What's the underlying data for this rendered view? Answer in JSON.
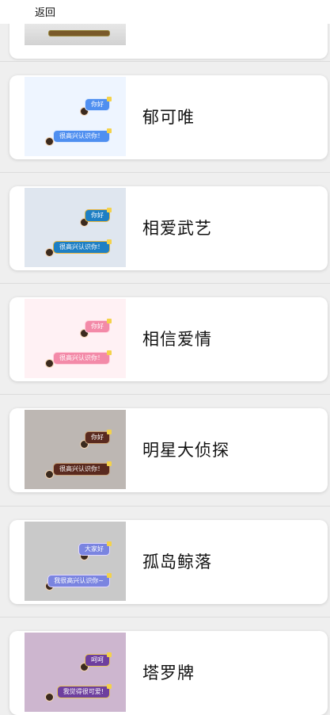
{
  "header": {
    "back_label": "返回"
  },
  "themes": [
    {
      "title": "郁可唯",
      "bubble_short": "你好",
      "bubble_long": "很高兴认识你！",
      "bg": "#eef5ff",
      "bubble_color": "#4f8ff0",
      "border_color": "#d6e6ff",
      "text_color": "#ffffff"
    },
    {
      "title": "相爱武艺",
      "bubble_short": "你好",
      "bubble_long": "很高兴认识你！",
      "bg": "#dfe6ef",
      "bubble_color": "#1d7fc4",
      "border_color": "#e7b43a",
      "text_color": "#ffffff"
    },
    {
      "title": "相信爱情",
      "bubble_short": "你好",
      "bubble_long": "很高兴认识你！",
      "bg": "#fff1f4",
      "bubble_color": "#f38aa8",
      "border_color": "#ffd1dd",
      "text_color": "#ffffff"
    },
    {
      "title": "明星大侦探",
      "bubble_short": "你好",
      "bubble_long": "很高兴认识你！",
      "bg": "#bdb7b3",
      "bubble_color": "#5a2a1f",
      "border_color": "#c9a27a",
      "text_color": "#ffffff"
    },
    {
      "title": "孤岛鲸落",
      "bubble_short": "大家好",
      "bubble_long": "我很高兴认识你~",
      "bg": "#c9c9c9",
      "bubble_color": "#7a84e0",
      "border_color": "#e2d8ff",
      "text_color": "#ffffff"
    },
    {
      "title": "塔罗牌",
      "bubble_short": "呵呵",
      "bubble_long": "我觉得很可爱!",
      "bg": "#cdb6cf",
      "bubble_color": "#6e3f9e",
      "border_color": "#e7c75a",
      "text_color": "#ffffff"
    }
  ]
}
